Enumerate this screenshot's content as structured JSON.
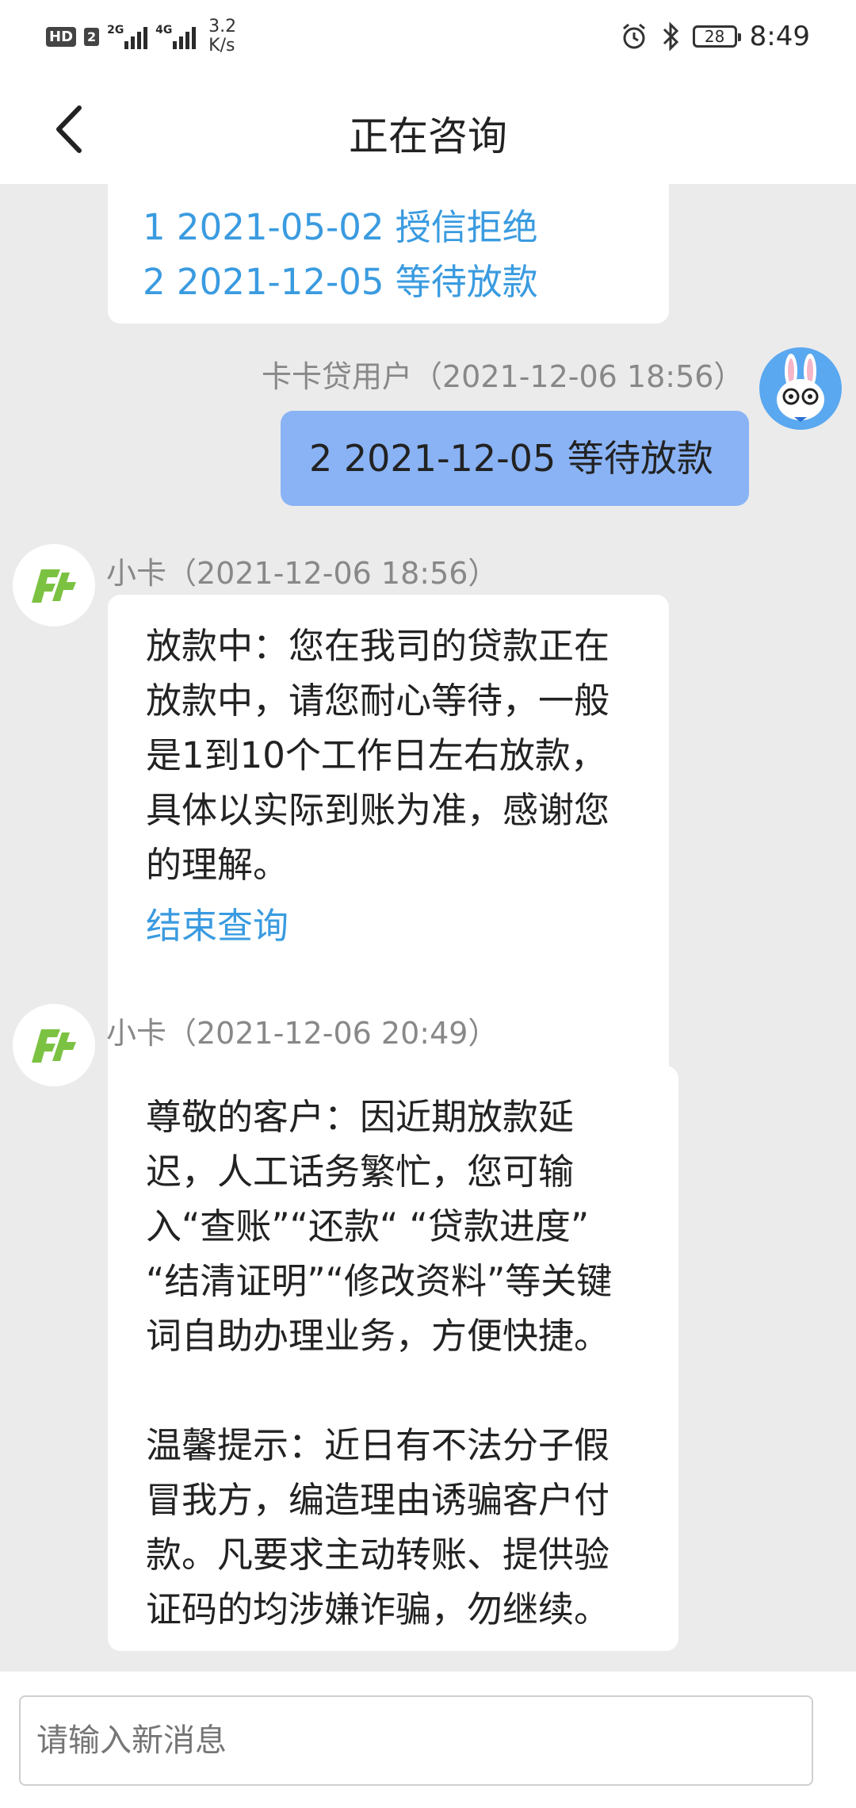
{
  "status_bar": {
    "hd_label": "HD",
    "sim_number": "2",
    "signal_1_label": "2G",
    "signal_2_label": "4G",
    "net_speed": "3.2\nK/s",
    "battery": "28",
    "time": "8:49"
  },
  "header": {
    "title": "正在咨询"
  },
  "messages": {
    "top_bubble": {
      "option1": "1 2021-05-02 授信拒绝",
      "option2": "2 2021-12-05 等待放款"
    },
    "user_msg": {
      "sender": "卡卡贷用户（2021-12-06 18:56）",
      "text": "2 2021-12-05 等待放款"
    },
    "bot_msg1": {
      "sender": "小卡（2021-12-06 18:56）",
      "text": "放款中：您在我司的贷款正在\n放款中，请您耐心等待，一般\n是1到10个工作日左右放款，\n具体以实际到账为准，感谢您\n的理解。",
      "link": "结束查询"
    },
    "bot_msg2": {
      "sender": "小卡（2021-12-06 20:49）",
      "text": "尊敬的客户：因近期放款延\n迟，人工话务繁忙，您可输\n入“查账”“还款“ “贷款进度”\n“结清证明”“修改资料”等关键\n词自助办理业务，方便快捷。\n\n温馨提示：近日有不法分子假\n冒我方，编造理由诱骗客户付\n款。凡要求主动转账、提供验\n证码的均涉嫌诈骗，勿继续。"
    }
  },
  "input": {
    "placeholder": "请输入新消息"
  },
  "colors": {
    "chat_background": "#ebebeb",
    "user_bubble": "#8ab3f5",
    "link": "#3a9be0",
    "bot_logo": "#7cc242"
  },
  "icons": {
    "back": "chevron-left-icon",
    "bot_avatar": "kaka-logo-icon",
    "user_avatar": "rabbit-avatar-icon"
  }
}
